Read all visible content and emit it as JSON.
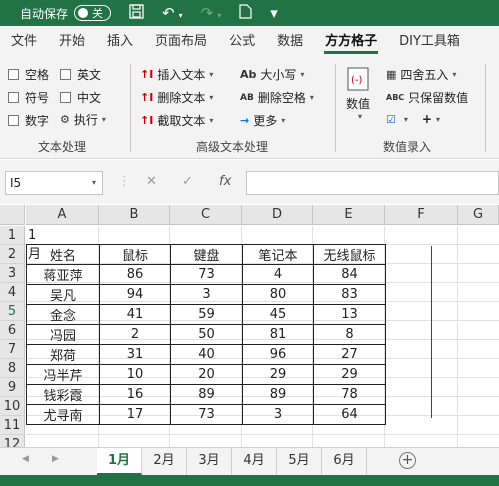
{
  "titlebar": {
    "autosave_label": "自动保存",
    "autosave_state": "关",
    "icons": [
      "save-icon",
      "undo-icon",
      "redo-icon",
      "document-icon",
      "more-icon"
    ]
  },
  "ribbon_tabs": [
    "文件",
    "开始",
    "插入",
    "页面布局",
    "公式",
    "数据",
    "方方格子",
    "DIY工具箱"
  ],
  "active_tab": "方方格子",
  "ribbon": {
    "text_processing": {
      "checkboxes": [
        "空格",
        "英文",
        "符号",
        "中文",
        "数字"
      ],
      "execute_label": "执行",
      "group_label": "文本处理"
    },
    "advanced_text": {
      "insert_text": "插入文本",
      "delete_text": "删除文本",
      "extract_text": "截取文本",
      "case_label": "大小写",
      "case_icon_text": "Ab",
      "delete_space": "删除空格",
      "delete_space_icon_text": "AB",
      "more_label": "更多",
      "group_label": "高级文本处理"
    },
    "number_entry": {
      "numeric_label": "数值",
      "round_label": "四舍五入",
      "keep_numeric": "只保留数值",
      "keep_numeric_icon_text": "ABC",
      "group_label": "数值录入"
    }
  },
  "formula_bar": {
    "name_box": "I5",
    "fx": "fx",
    "content": ""
  },
  "columns": [
    "A",
    "B",
    "C",
    "D",
    "E",
    "F",
    "G"
  ],
  "rows": [
    "1",
    "2",
    "3",
    "4",
    "5",
    "6",
    "7",
    "8",
    "9",
    "10",
    "11",
    "12"
  ],
  "selected_row": "5",
  "sheet": {
    "title_cell": "1月",
    "headers": [
      "姓名",
      "鼠标",
      "键盘",
      "笔记本",
      "无线鼠标"
    ],
    "rows": [
      [
        "蒋亚萍",
        "86",
        "73",
        "4",
        "84"
      ],
      [
        "吴凡",
        "94",
        "3",
        "80",
        "83"
      ],
      [
        "金念",
        "41",
        "59",
        "45",
        "13"
      ],
      [
        "冯园",
        "2",
        "50",
        "81",
        "8"
      ],
      [
        "郑荷",
        "31",
        "40",
        "96",
        "27"
      ],
      [
        "冯半芹",
        "10",
        "20",
        "29",
        "29"
      ],
      [
        "钱彩霞",
        "16",
        "89",
        "89",
        "78"
      ],
      [
        "尤寻南",
        "17",
        "73",
        "3",
        "64"
      ]
    ]
  },
  "sheet_tabs": [
    "1月",
    "2月",
    "3月",
    "4月",
    "5月",
    "6月"
  ],
  "active_sheet": "1月",
  "colors": {
    "brand_green": "#217346",
    "ribbon_bg": "#f3f3f3"
  }
}
